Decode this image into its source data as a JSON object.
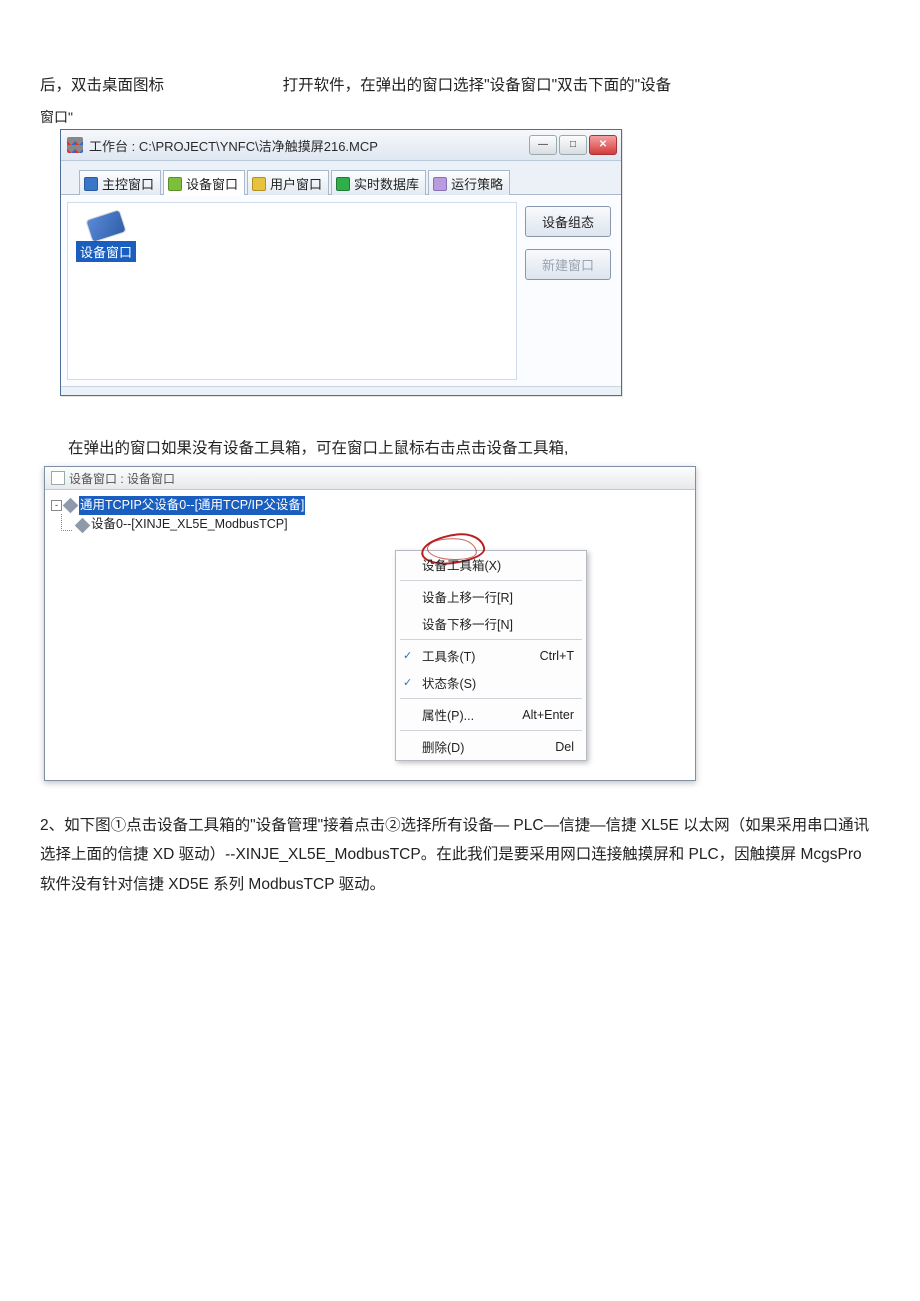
{
  "intro": {
    "line1a": "后，双击桌面图标",
    "line1b": "打开软件，在弹出的窗口选择\"设备窗口\"双击下面的\"设备",
    "trail": "窗口\""
  },
  "win1": {
    "title": "工作台 : C:\\PROJECT\\YNFC\\洁净触摸屏216.MCP",
    "ctrl_min": "—",
    "ctrl_max": "□",
    "ctrl_close": "✕",
    "tabs": {
      "main": "主控窗口",
      "device": "设备窗口",
      "user": "用户窗口",
      "rtdb": "实时数据库",
      "strategy": "运行策略"
    },
    "device_item_label": "设备窗口",
    "btn_config": "设备组态",
    "btn_new": "新建窗口"
  },
  "mid_line": "在弹出的窗口如果没有设备工具箱，可在窗口上鼠标右击点击设备工具箱,",
  "win2": {
    "title": "设备窗口 : 设备窗口",
    "tree": {
      "parent_label": "通用TCPIP父设备0--[通用TCP/IP父设备]",
      "child_label": "设备0--[XINJE_XL5E_ModbusTCP]"
    },
    "menu": {
      "toolbox": "设备工具箱(X)",
      "moveup": "设备上移一行[R]",
      "movedown": "设备下移一行[N]",
      "toolbar": "工具条(T)",
      "toolbar_sc": "Ctrl+T",
      "statusbar": "状态条(S)",
      "props": "属性(P)...",
      "props_sc": "Alt+Enter",
      "delete": "删除(D)",
      "delete_sc": "Del"
    }
  },
  "final": "2、如下图①点击设备工具箱的\"设备管理\"接着点击②选择所有设备— PLC—信捷—信捷 XL5E 以太网（如果采用串口通讯选择上面的信捷 XD 驱动）--XINJE_XL5E_ModbusTCP。在此我们是要采用网口连接触摸屏和 PLC，因触摸屏 McgsPro 软件没有针对信捷 XD5E 系列 ModbusTCP 驱动。"
}
